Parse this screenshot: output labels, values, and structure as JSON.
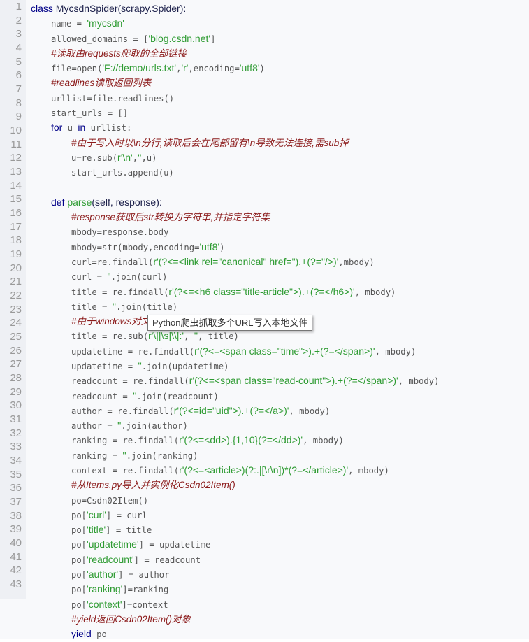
{
  "code": {
    "line_numbers": [
      "1",
      "2",
      "3",
      "4",
      "5",
      "6",
      "7",
      "8",
      "9",
      "10",
      "11",
      "12",
      "13",
      "14",
      "15",
      "16",
      "17",
      "18",
      "19",
      "20",
      "21",
      "22",
      "23",
      "24",
      "25",
      "26",
      "27",
      "28",
      "29",
      "30",
      "31",
      "32",
      "33",
      "34",
      "35",
      "36",
      "37",
      "38",
      "39",
      "40",
      "41",
      "42",
      "43"
    ],
    "lines": [
      {
        "indent": 0,
        "tokens": [
          {
            "t": "k",
            "v": "class"
          },
          {
            "t": "n",
            "v": " MycsdnSpider(scrapy.Spider):"
          }
        ]
      },
      {
        "indent": 1,
        "tokens": [
          {
            "t": "p",
            "v": "name = "
          },
          {
            "t": "s",
            "v": "'mycsdn'"
          }
        ]
      },
      {
        "indent": 1,
        "tokens": [
          {
            "t": "p",
            "v": "allowed_domains = ["
          },
          {
            "t": "s",
            "v": "'blog.csdn.net'"
          },
          {
            "t": "p",
            "v": "]"
          }
        ]
      },
      {
        "indent": 1,
        "tokens": [
          {
            "t": "c",
            "v": "#读取由requests爬取的全部链接"
          }
        ]
      },
      {
        "indent": 1,
        "tokens": [
          {
            "t": "p",
            "v": "file=open("
          },
          {
            "t": "s",
            "v": "'F://demo/urls.txt'"
          },
          {
            "t": "p",
            "v": ","
          },
          {
            "t": "s",
            "v": "'r'"
          },
          {
            "t": "p",
            "v": ",encoding="
          },
          {
            "t": "s",
            "v": "'utf8'"
          },
          {
            "t": "p",
            "v": ")"
          }
        ]
      },
      {
        "indent": 1,
        "tokens": [
          {
            "t": "c",
            "v": "#readlines读取返回列表"
          }
        ]
      },
      {
        "indent": 1,
        "tokens": [
          {
            "t": "p",
            "v": "urllist=file.readlines()"
          }
        ]
      },
      {
        "indent": 1,
        "tokens": [
          {
            "t": "p",
            "v": "start_urls = []"
          }
        ]
      },
      {
        "indent": 1,
        "tokens": [
          {
            "t": "k",
            "v": "for"
          },
          {
            "t": "p",
            "v": " u "
          },
          {
            "t": "k",
            "v": "in"
          },
          {
            "t": "p",
            "v": " urllist:"
          }
        ]
      },
      {
        "indent": 2,
        "tokens": [
          {
            "t": "c",
            "v": "#由于写入时以\\n分行,读取后会在尾部留有\\n导致无法连接,需sub掉"
          }
        ]
      },
      {
        "indent": 2,
        "tokens": [
          {
            "t": "p",
            "v": "u=re.sub("
          },
          {
            "t": "s",
            "v": "r'\\n'"
          },
          {
            "t": "p",
            "v": ","
          },
          {
            "t": "s",
            "v": "''"
          },
          {
            "t": "p",
            "v": ",u)"
          }
        ]
      },
      {
        "indent": 2,
        "tokens": [
          {
            "t": "p",
            "v": "start_urls.append(u)"
          }
        ]
      },
      {
        "indent": 0,
        "tokens": []
      },
      {
        "indent": 1,
        "tokens": [
          {
            "t": "k",
            "v": "def"
          },
          {
            "t": "n",
            "v": " "
          },
          {
            "t": "f",
            "v": "parse"
          },
          {
            "t": "n",
            "v": "(self, response):"
          }
        ]
      },
      {
        "indent": 2,
        "tokens": [
          {
            "t": "c",
            "v": "#response获取后str转换为字符串,并指定字符集"
          }
        ]
      },
      {
        "indent": 2,
        "tokens": [
          {
            "t": "p",
            "v": "mbody=response.body"
          }
        ]
      },
      {
        "indent": 2,
        "tokens": [
          {
            "t": "p",
            "v": "mbody=str(mbody,encoding="
          },
          {
            "t": "s",
            "v": "'utf8'"
          },
          {
            "t": "p",
            "v": ")"
          }
        ]
      },
      {
        "indent": 2,
        "tokens": [
          {
            "t": "p",
            "v": "curl=re.findall("
          },
          {
            "t": "s",
            "v": "r'(?<=<link rel=\"canonical\" href=\").+(?=\"/>)'"
          },
          {
            "t": "p",
            "v": ",mbody)"
          }
        ]
      },
      {
        "indent": 2,
        "tokens": [
          {
            "t": "p",
            "v": "curl = "
          },
          {
            "t": "s",
            "v": "''"
          },
          {
            "t": "p",
            "v": ".join(curl)"
          }
        ]
      },
      {
        "indent": 2,
        "tokens": [
          {
            "t": "p",
            "v": "title = re.findall("
          },
          {
            "t": "s",
            "v": "r'(?<=<h6 class=\"title-article\">).+(?=</h6>)'"
          },
          {
            "t": "p",
            "v": ", mbody)"
          }
        ]
      },
      {
        "indent": 2,
        "tokens": [
          {
            "t": "p",
            "v": "title = "
          },
          {
            "t": "s",
            "v": "''"
          },
          {
            "t": "p",
            "v": ".join(title)"
          }
        ]
      },
      {
        "indent": 2,
        "tokens": [
          {
            "t": "c",
            "v": "#由于windows对文"
          }
        ]
      },
      {
        "indent": 2,
        "tokens": [
          {
            "t": "p",
            "v": "title = re.sub("
          },
          {
            "t": "s",
            "v": "r'\\||\\s|\\\\|:'"
          },
          {
            "t": "p",
            "v": ", "
          },
          {
            "t": "s",
            "v": "''"
          },
          {
            "t": "p",
            "v": ", title)"
          }
        ]
      },
      {
        "indent": 2,
        "tokens": [
          {
            "t": "p",
            "v": "updatetime = re.findall("
          },
          {
            "t": "s",
            "v": "r'(?<=<span class=\"time\">).+(?=</span>)'"
          },
          {
            "t": "p",
            "v": ", mbody)"
          }
        ]
      },
      {
        "indent": 2,
        "tokens": [
          {
            "t": "p",
            "v": "updatetime = "
          },
          {
            "t": "s",
            "v": "''"
          },
          {
            "t": "p",
            "v": ".join(updatetime)"
          }
        ]
      },
      {
        "indent": 2,
        "tokens": [
          {
            "t": "p",
            "v": "readcount = re.findall("
          },
          {
            "t": "s",
            "v": "r'(?<=<span class=\"read-count\">).+(?=</span>)'"
          },
          {
            "t": "p",
            "v": ", mbody)"
          }
        ]
      },
      {
        "indent": 2,
        "tokens": [
          {
            "t": "p",
            "v": "readcount = "
          },
          {
            "t": "s",
            "v": "''"
          },
          {
            "t": "p",
            "v": ".join(readcount)"
          }
        ]
      },
      {
        "indent": 2,
        "tokens": [
          {
            "t": "p",
            "v": "author = re.findall("
          },
          {
            "t": "s",
            "v": "r'(?<=id=\"uid\">).+(?=</a>)'"
          },
          {
            "t": "p",
            "v": ", mbody)"
          }
        ]
      },
      {
        "indent": 2,
        "tokens": [
          {
            "t": "p",
            "v": "author = "
          },
          {
            "t": "s",
            "v": "''"
          },
          {
            "t": "p",
            "v": ".join(author)"
          }
        ]
      },
      {
        "indent": 2,
        "tokens": [
          {
            "t": "p",
            "v": "ranking = re.findall("
          },
          {
            "t": "s",
            "v": "r'(?<=<dd>).{1,10}(?=</dd>)'"
          },
          {
            "t": "p",
            "v": ", mbody)"
          }
        ]
      },
      {
        "indent": 2,
        "tokens": [
          {
            "t": "p",
            "v": "ranking = "
          },
          {
            "t": "s",
            "v": "''"
          },
          {
            "t": "p",
            "v": ".join(ranking)"
          }
        ]
      },
      {
        "indent": 2,
        "tokens": [
          {
            "t": "p",
            "v": "context = re.findall("
          },
          {
            "t": "s",
            "v": "r'(?<=<article>)(?:.|[\\r\\n])*(?=</article>)'"
          },
          {
            "t": "p",
            "v": ", mbody)"
          }
        ]
      },
      {
        "indent": 2,
        "tokens": [
          {
            "t": "c",
            "v": "#从Items.py导入并实例化Csdn02Item()"
          }
        ]
      },
      {
        "indent": 2,
        "tokens": [
          {
            "t": "p",
            "v": "po=Csdn02Item()"
          }
        ]
      },
      {
        "indent": 2,
        "tokens": [
          {
            "t": "p",
            "v": "po["
          },
          {
            "t": "s",
            "v": "'curl'"
          },
          {
            "t": "p",
            "v": "] = curl"
          }
        ]
      },
      {
        "indent": 2,
        "tokens": [
          {
            "t": "p",
            "v": "po["
          },
          {
            "t": "s",
            "v": "'title'"
          },
          {
            "t": "p",
            "v": "] = title"
          }
        ]
      },
      {
        "indent": 2,
        "tokens": [
          {
            "t": "p",
            "v": "po["
          },
          {
            "t": "s",
            "v": "'updatetime'"
          },
          {
            "t": "p",
            "v": "] = updatetime"
          }
        ]
      },
      {
        "indent": 2,
        "tokens": [
          {
            "t": "p",
            "v": "po["
          },
          {
            "t": "s",
            "v": "'readcount'"
          },
          {
            "t": "p",
            "v": "] = readcount"
          }
        ]
      },
      {
        "indent": 2,
        "tokens": [
          {
            "t": "p",
            "v": "po["
          },
          {
            "t": "s",
            "v": "'author'"
          },
          {
            "t": "p",
            "v": "] = author"
          }
        ]
      },
      {
        "indent": 2,
        "tokens": [
          {
            "t": "p",
            "v": "po["
          },
          {
            "t": "s",
            "v": "'ranking'"
          },
          {
            "t": "p",
            "v": "]=ranking"
          }
        ]
      },
      {
        "indent": 2,
        "tokens": [
          {
            "t": "p",
            "v": "po["
          },
          {
            "t": "s",
            "v": "'context'"
          },
          {
            "t": "p",
            "v": "]=context"
          }
        ]
      },
      {
        "indent": 2,
        "tokens": [
          {
            "t": "c",
            "v": "#yield返回Csdn02Item()对象"
          }
        ]
      },
      {
        "indent": 2,
        "tokens": [
          {
            "t": "k",
            "v": "yield"
          },
          {
            "t": "p",
            "v": " po"
          }
        ]
      }
    ]
  },
  "tooltip": {
    "text": "Python爬虫抓取多个URL写入本地文件"
  },
  "colors": {
    "keyword": "#000088",
    "string": "#2e9b32",
    "comment": "#8b1a1a",
    "plain": "#555555",
    "gutter_bg": "#eef0f4"
  }
}
